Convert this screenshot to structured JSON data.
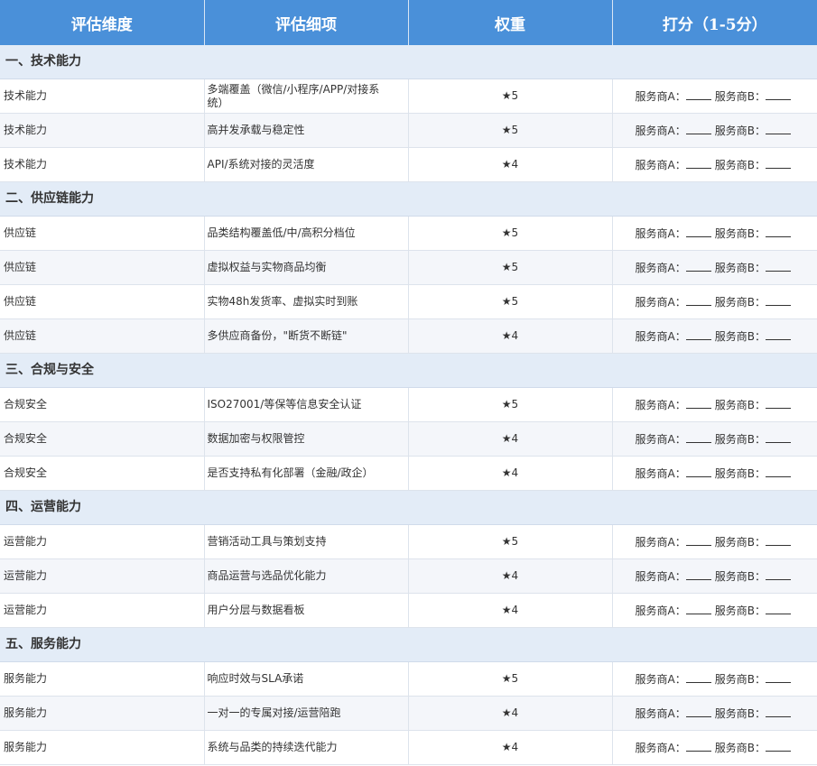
{
  "header": {
    "col1": "评估维度",
    "col2": "评估细项",
    "col3": "权重",
    "col4": "打分（1-5分）"
  },
  "score_template": {
    "a_label": "服务商A：",
    "b_label": "服务商B："
  },
  "sections": [
    {
      "title": "一、技术能力",
      "rows": [
        {
          "dimension": "技术能力",
          "item": "多端覆盖（微信/小程序/APP/对接系统）",
          "weight": "★5"
        },
        {
          "dimension": "技术能力",
          "item": "高并发承载与稳定性",
          "weight": "★5"
        },
        {
          "dimension": "技术能力",
          "item": "API/系统对接的灵活度",
          "weight": "★4"
        }
      ]
    },
    {
      "title": "二、供应链能力",
      "rows": [
        {
          "dimension": "供应链",
          "item": "品类结构覆盖低/中/高积分档位",
          "weight": "★5"
        },
        {
          "dimension": "供应链",
          "item": "虚拟权益与实物商品均衡",
          "weight": "★5"
        },
        {
          "dimension": "供应链",
          "item": "实物48h发货率、虚拟实时到账",
          "weight": "★5"
        },
        {
          "dimension": "供应链",
          "item": "多供应商备份，\"断货不断链\"",
          "weight": "★4"
        }
      ]
    },
    {
      "title": "三、合规与安全",
      "rows": [
        {
          "dimension": "合规安全",
          "item": "ISO27001/等保等信息安全认证",
          "weight": "★5"
        },
        {
          "dimension": "合规安全",
          "item": "数据加密与权限管控",
          "weight": "★4"
        },
        {
          "dimension": "合规安全",
          "item": "是否支持私有化部署（金融/政企）",
          "weight": "★4"
        }
      ]
    },
    {
      "title": "四、运营能力",
      "rows": [
        {
          "dimension": "运营能力",
          "item": "营销活动工具与策划支持",
          "weight": "★5"
        },
        {
          "dimension": "运营能力",
          "item": "商品运营与选品优化能力",
          "weight": "★4"
        },
        {
          "dimension": "运营能力",
          "item": "用户分层与数据看板",
          "weight": "★4"
        }
      ]
    },
    {
      "title": "五、服务能力",
      "rows": [
        {
          "dimension": "服务能力",
          "item": "响应时效与SLA承诺",
          "weight": "★5"
        },
        {
          "dimension": "服务能力",
          "item": "一对一的专属对接/运营陪跑",
          "weight": "★4"
        },
        {
          "dimension": "服务能力",
          "item": "系统与品类的持续迭代能力",
          "weight": "★4"
        }
      ]
    }
  ],
  "colors": {
    "header_bg": "#4a90d9",
    "section_bg": "#e3ecf7",
    "alt_row_bg": "#f4f6fa"
  }
}
